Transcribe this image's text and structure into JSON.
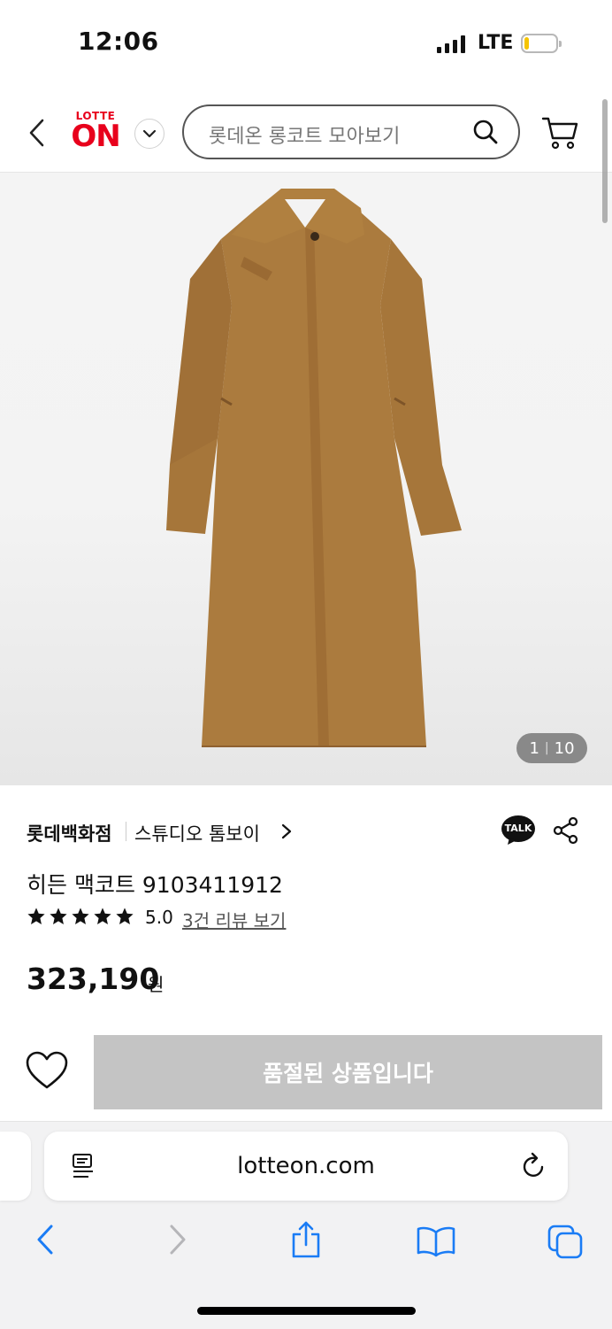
{
  "status_bar": {
    "time": "12:06",
    "network": "LTE"
  },
  "header": {
    "logo_top": "LOTTE",
    "logo_main": "ON",
    "search_placeholder": "롯데온 롱코트 모아보기"
  },
  "product": {
    "image_counter": {
      "current": "1",
      "separator": "|",
      "total": "10"
    },
    "store": "롯데백화점",
    "brand": "스튜디오 톰보이",
    "talk_label": "TALK",
    "title": "히든 맥코트 9103411912",
    "rating": "5.0",
    "stars": 5,
    "review_link": "3건 리뷰 보기",
    "price": "323,190",
    "currency": "원",
    "soldout_label": "품절된 상품입니다"
  },
  "browser": {
    "url": "lotteon.com"
  },
  "colors": {
    "brand_red": "#e8001c",
    "safari_blue": "#1a7cf5",
    "coat": "#a6763a"
  }
}
